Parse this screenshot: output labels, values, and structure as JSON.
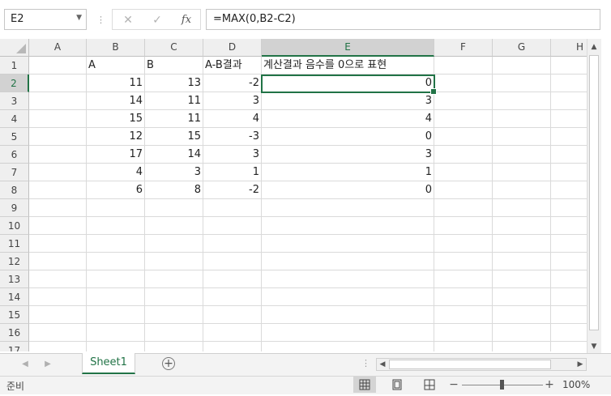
{
  "formula_bar": {
    "name_box": "E2",
    "cancel_glyph": "✕",
    "enter_glyph": "✓",
    "fx_label": "fx",
    "formula": "=MAX(0,B2-C2)"
  },
  "sheet": {
    "columns": [
      "A",
      "B",
      "C",
      "D",
      "E",
      "F",
      "G",
      "H"
    ],
    "selected_column": "E",
    "selected_row": "2",
    "row_headers": [
      "1",
      "2",
      "3",
      "4",
      "5",
      "6",
      "7",
      "8",
      "9",
      "10",
      "11",
      "12",
      "13",
      "14",
      "15",
      "16",
      "17"
    ],
    "rows": [
      {
        "A": "",
        "B": "A",
        "C": "B",
        "D": "A-B결과",
        "E": "계산결과 음수를 0으로 표현"
      },
      {
        "A": "",
        "B": "11",
        "C": "13",
        "D": "-2",
        "E": "0"
      },
      {
        "A": "",
        "B": "14",
        "C": "11",
        "D": "3",
        "E": "3"
      },
      {
        "A": "",
        "B": "15",
        "C": "11",
        "D": "4",
        "E": "4"
      },
      {
        "A": "",
        "B": "12",
        "C": "15",
        "D": "-3",
        "E": "0"
      },
      {
        "A": "",
        "B": "17",
        "C": "14",
        "D": "3",
        "E": "3"
      },
      {
        "A": "",
        "B": "4",
        "C": "3",
        "D": "1",
        "E": "1"
      },
      {
        "A": "",
        "B": "6",
        "C": "8",
        "D": "-2",
        "E": "0"
      }
    ]
  },
  "tabs": {
    "sheet_name": "Sheet1",
    "add_glyph": "+"
  },
  "status_bar": {
    "ready": "준비",
    "zoom_minus": "−",
    "zoom_plus": "+",
    "zoom": "100%",
    "zoom_level_percent": 100
  },
  "colors": {
    "accent": "#217346",
    "header_bg": "#efefef",
    "selected_header_bg": "#d2d2d2"
  },
  "icons": {
    "name_box_dropdown": "chevron-down-icon",
    "cancel": "close-icon",
    "enter": "check-icon",
    "function": "function-icon",
    "add_sheet": "plus-circle-icon",
    "normal_view": "grid-view-icon",
    "page_layout": "page-layout-icon",
    "page_break": "page-break-icon"
  }
}
